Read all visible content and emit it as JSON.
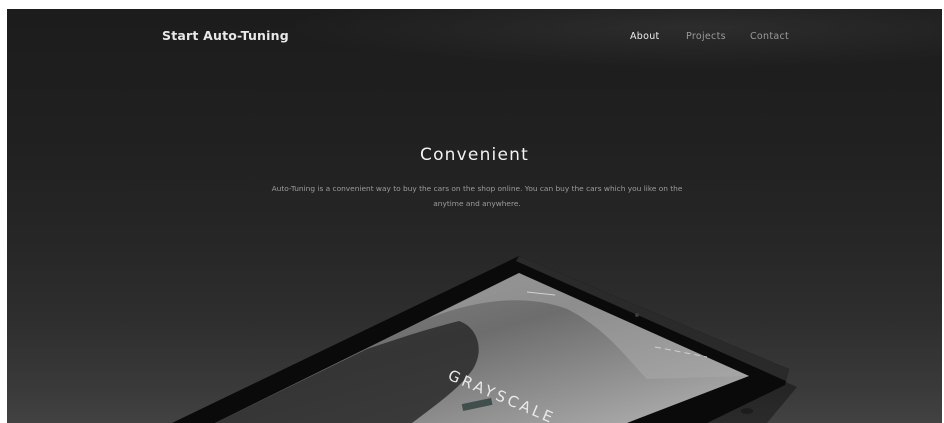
{
  "nav": {
    "brand": "Start Auto-Tuning",
    "links": [
      "About",
      "Projects",
      "Contact"
    ]
  },
  "hero": {
    "title": "Convenient",
    "text": "Auto-Tuning is a convenient way to buy the cars on the shop online. You can buy the cars which you like on the anytime and anywhere."
  },
  "tablet_screen": {
    "heading": "GRAYSCALE"
  },
  "colors": {
    "background_top": "#1c1c1c",
    "background_bottom": "#424242",
    "text_primary": "#f2f2f2",
    "text_muted": "#9c9c9c"
  }
}
